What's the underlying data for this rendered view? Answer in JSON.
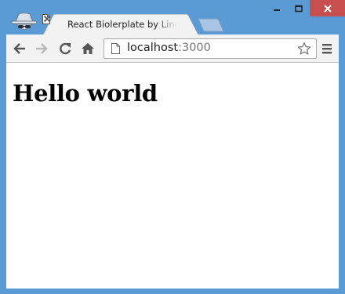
{
  "window": {
    "accent": "#5b9bd5",
    "close_color": "#c7504f"
  },
  "tab": {
    "title": "React Biolerplate by Lingh",
    "favicon": "page-icon",
    "close": "close-icon"
  },
  "toolbar": {
    "back": "back-arrow-icon",
    "forward": "forward-arrow-icon",
    "reload": "reload-icon",
    "home": "home-icon",
    "url_host": "localhost",
    "url_port": ":3000",
    "bookmark": "star-icon",
    "menu": "hamburger-menu-icon"
  },
  "page": {
    "heading": "Hello world"
  }
}
